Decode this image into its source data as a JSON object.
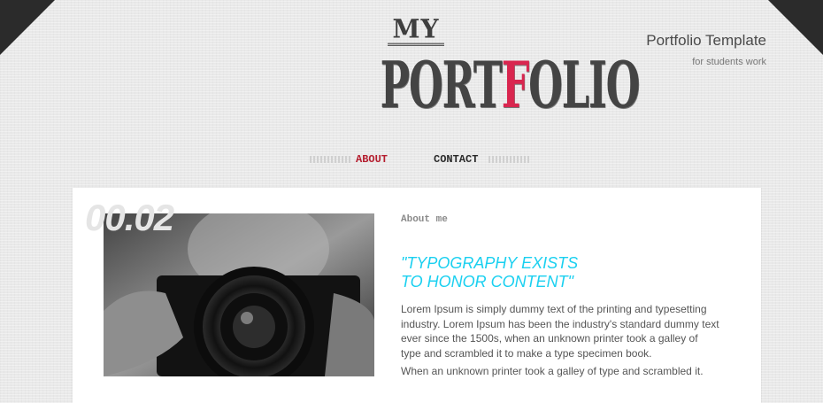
{
  "logo": {
    "my": "MY",
    "main_pre": "PORT",
    "main_accent": "F",
    "main_post": "OLIO",
    "accent_color": "#d9264f"
  },
  "tagline": {
    "title": "Portfolio Template",
    "subtitle": "for students work"
  },
  "nav": {
    "items": [
      {
        "label": "ABOUT",
        "active": true
      },
      {
        "label": "CONTACT",
        "active": false
      }
    ]
  },
  "content": {
    "page_number": "00.02",
    "section_label": "About me",
    "quote": "\"TYPOGRAPHY EXISTS\nTO HONOR CONTENT\"",
    "paragraph1": "Lorem Ipsum is simply dummy text of the printing and typesetting industry. Lorem Ipsum has been the industry's standard dummy text ever since the 1500s, when an unknown printer took a galley of type and scrambled it to make a type specimen book.",
    "paragraph2": "When an unknown printer took a galley of type and scrambled it.",
    "photo_icon": "camera-photo"
  },
  "colors": {
    "quote": "#1ad0f0",
    "nav_active": "#b51e2f",
    "corner": "#2b2b2b"
  }
}
